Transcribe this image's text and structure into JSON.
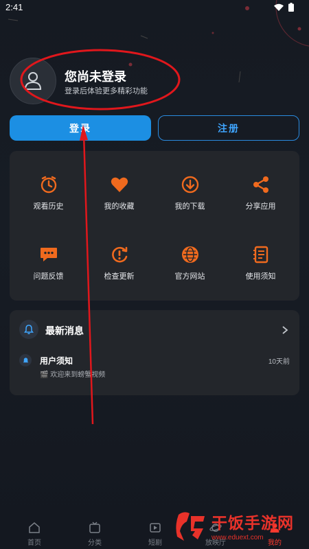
{
  "status_bar": {
    "time": "2:41",
    "icons": [
      "wifi-icon",
      "battery-icon"
    ]
  },
  "profile": {
    "title": "您尚未登录",
    "subtitle": "登录后体验更多精彩功能",
    "avatar_icon": "user-silhouette-icon"
  },
  "auth": {
    "login_label": "登录",
    "register_label": "注册"
  },
  "menu": {
    "accent": "#f06a1e",
    "items": [
      {
        "label": "观看历史",
        "icon": "clock-icon"
      },
      {
        "label": "我的收藏",
        "icon": "heart-icon"
      },
      {
        "label": "我的下载",
        "icon": "download-icon"
      },
      {
        "label": "分享应用",
        "icon": "share-icon"
      },
      {
        "label": "问题反馈",
        "icon": "chat-bubble-icon"
      },
      {
        "label": "检查更新",
        "icon": "refresh-alert-icon"
      },
      {
        "label": "官方网站",
        "icon": "globe-icon"
      },
      {
        "label": "使用须知",
        "icon": "notebook-icon"
      }
    ]
  },
  "messages": {
    "title": "最新消息",
    "notice": {
      "title": "用户须知",
      "time": "10天前",
      "text": "🎬 欢迎来到螃蟹视频"
    }
  },
  "tabs": [
    {
      "label": "首页",
      "icon": "home-icon"
    },
    {
      "label": "分类",
      "icon": "tv-icon"
    },
    {
      "label": "短剧",
      "icon": "video-icon"
    },
    {
      "label": "放映厅",
      "icon": "planet-icon"
    },
    {
      "label": "我的",
      "icon": "user-icon",
      "active": true
    }
  ],
  "watermark": {
    "text": "干饭手游网",
    "url": "www.eduext.com"
  },
  "colors": {
    "primary": "#1c8fe3",
    "annotation": "#e0171c",
    "card": "#23262b"
  }
}
